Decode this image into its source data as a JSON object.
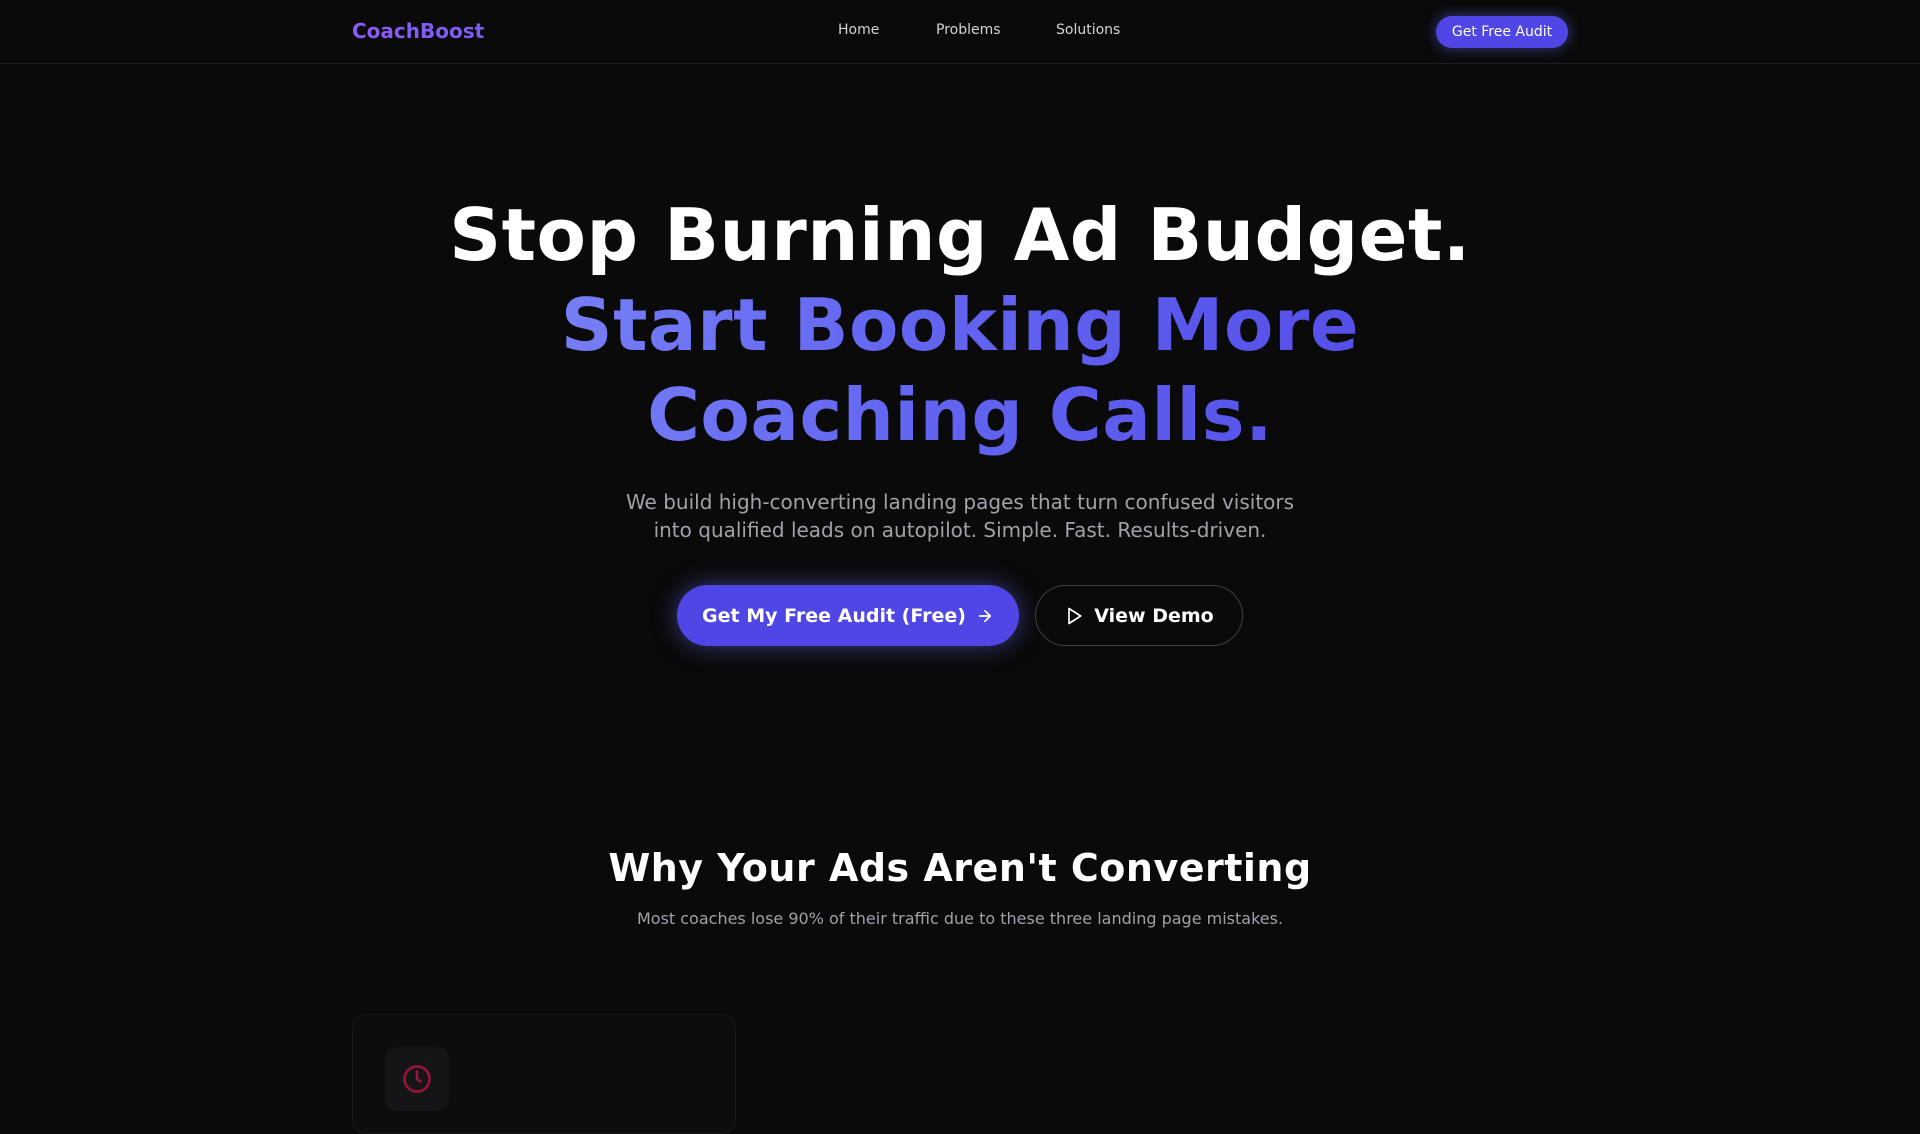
{
  "nav": {
    "logo": "CoachBoost",
    "links": [
      {
        "label": "Home"
      },
      {
        "label": "Problems"
      },
      {
        "label": "Solutions"
      }
    ],
    "cta_label": "Get Free Audit"
  },
  "hero": {
    "headline_line1": "Stop Burning Ad Budget.",
    "headline_line2": "Start Booking More Coaching Calls.",
    "subtitle": "We build high-converting landing pages that turn confused visitors into qualified leads on autopilot. Simple. Fast. Results-driven.",
    "primary_cta": "Get My Free Audit (Free)",
    "primary_cta_icon": "arrow-right-icon",
    "secondary_cta": "View Demo",
    "secondary_cta_icon": "play-icon"
  },
  "problems": {
    "title": "Why Your Ads Aren't Converting",
    "subtitle": "Most coaches lose 90% of their traffic due to these three landing page mistakes.",
    "cards": [
      {
        "icon": "clock-icon",
        "icon_color": "#9f1239"
      }
    ]
  },
  "colors": {
    "background": "#0a0a0a",
    "accent": "#4f46e5",
    "logo": "#8b5cf6",
    "muted_text": "#a1a1aa"
  }
}
